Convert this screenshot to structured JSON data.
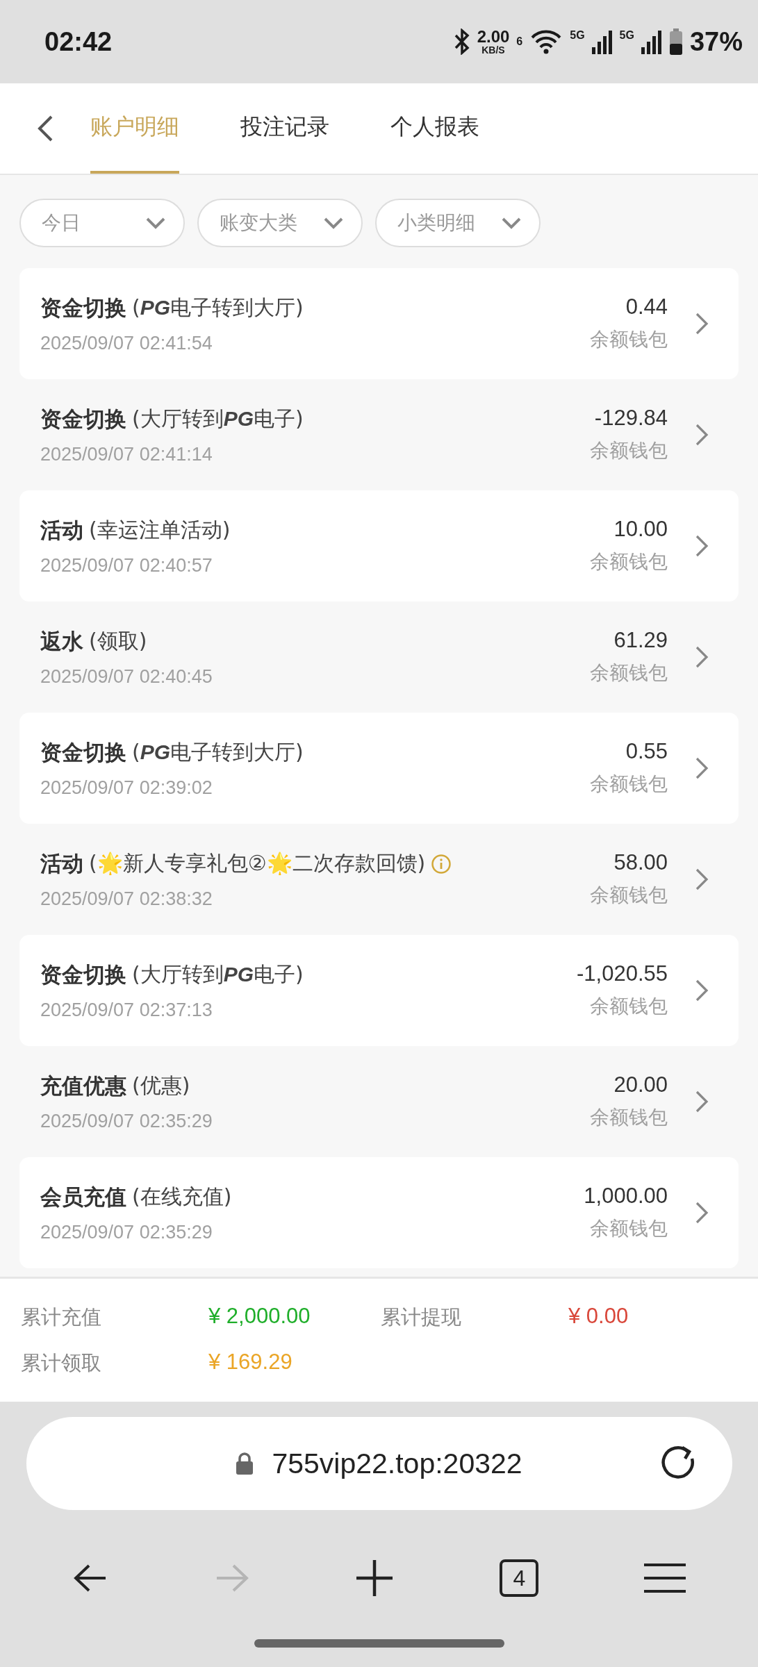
{
  "status_bar": {
    "time": "02:42",
    "net_speed": "2.00",
    "net_unit": "KB/S",
    "wifi_label": "6",
    "signal_labels": [
      "5G",
      "5G"
    ],
    "battery": "37%"
  },
  "tabs": [
    {
      "label": "账户明细",
      "selected": true
    },
    {
      "label": "投注记录",
      "selected": false
    },
    {
      "label": "个人报表",
      "selected": false
    }
  ],
  "filters": [
    {
      "label": "今日"
    },
    {
      "label": "账变大类"
    },
    {
      "label": "小类明细"
    }
  ],
  "records": [
    {
      "title": "资金切换",
      "detail": "(**PG**电子转到大厅)",
      "time": "2025/09/07 02:41:54",
      "amount": "0.44",
      "wallet": "余额钱包",
      "info": false
    },
    {
      "title": "资金切换",
      "detail": "(大厅转到**PG**电子)",
      "time": "2025/09/07 02:41:14",
      "amount": "-129.84",
      "wallet": "余额钱包",
      "info": false
    },
    {
      "title": "活动",
      "detail": "(幸运注单活动)",
      "time": "2025/09/07 02:40:57",
      "amount": "10.00",
      "wallet": "余额钱包",
      "info": false
    },
    {
      "title": "返水",
      "detail": "(领取)",
      "time": "2025/09/07 02:40:45",
      "amount": "61.29",
      "wallet": "余额钱包",
      "info": false
    },
    {
      "title": "资金切换",
      "detail": "(**PG**电子转到大厅)",
      "time": "2025/09/07 02:39:02",
      "amount": "0.55",
      "wallet": "余额钱包",
      "info": false
    },
    {
      "title": "活动",
      "detail": "(🌟新人专享礼包②🌟二次存款回馈)",
      "time": "2025/09/07 02:38:32",
      "amount": "58.00",
      "wallet": "余额钱包",
      "info": true
    },
    {
      "title": "资金切换",
      "detail": "(大厅转到**PG**电子)",
      "time": "2025/09/07 02:37:13",
      "amount": "-1,020.55",
      "wallet": "余额钱包",
      "info": false
    },
    {
      "title": "充值优惠",
      "detail": "(优惠)",
      "time": "2025/09/07 02:35:29",
      "amount": "20.00",
      "wallet": "余额钱包",
      "info": false
    },
    {
      "title": "会员充值",
      "detail": "(在线充值)",
      "time": "2025/09/07 02:35:29",
      "amount": "1,000.00",
      "wallet": "余额钱包",
      "info": false
    }
  ],
  "summary": [
    {
      "label": "累计充值",
      "value": "¥ 2,000.00",
      "color": "#1fae2a"
    },
    {
      "label": "累计提现",
      "value": "¥ 0.00",
      "color": "#d9473a"
    },
    {
      "label": "累计领取",
      "value": "¥ 169.29",
      "color": "#eaa526"
    }
  ],
  "browser": {
    "url": "755vip22.top:20322",
    "tab_count": "4",
    "forward_disabled": true
  }
}
